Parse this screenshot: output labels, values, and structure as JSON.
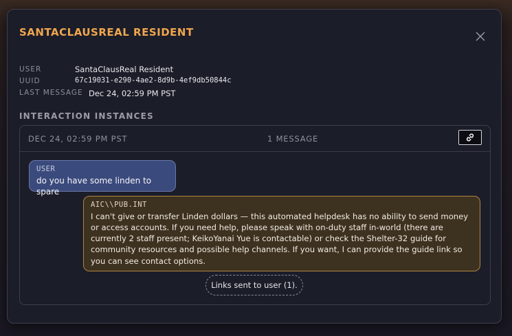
{
  "dialog": {
    "title": "SANTACLAUSREAL RESIDENT",
    "close_icon": "close-icon"
  },
  "meta": {
    "user_label": "USER",
    "user_value": "SantaClausReal Resident",
    "uuid_label": "UUID",
    "uuid_value": "67c19031-e290-4ae2-8d9b-4ef9db50844c",
    "last_message_label": "LAST MESSAGE",
    "last_message_value": "Dec 24, 02:59 PM PST"
  },
  "section_heading": "INTERACTION INSTANCES",
  "instance": {
    "date": "DEC 24, 02:59 PM PST",
    "message_count": "1 MESSAGE",
    "link_icon": "link-icon",
    "messages": [
      {
        "sender": "USER",
        "text": "do you have some linden to spare"
      },
      {
        "sender": "AIC\\\\PUB.INT",
        "text": "I can't give or transfer Linden dollars — this automated helpdesk has no ability to send money or access accounts. If you need help, please speak with on-duty staff in-world (there are currently 2 staff present; KeikoYanai Yue is contactable) or check the Shelter-32 guide for community resources and possible help channels. If you want, I can provide the guide link so you can see contact options."
      }
    ],
    "links_sent": "Links sent to user (1)."
  },
  "colors": {
    "accent_title": "#f0a64e",
    "user_bubble": "#3b4a7c",
    "bot_bubble": "#3d3120",
    "bot_bubble_border": "#b18641"
  }
}
